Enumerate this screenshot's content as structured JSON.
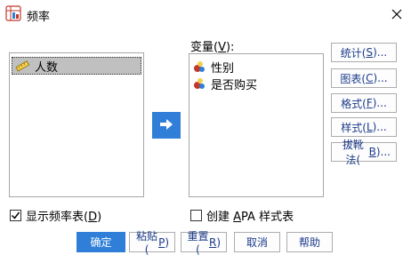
{
  "window": {
    "title": "频率"
  },
  "source_list": {
    "items": [
      {
        "label": "人数"
      }
    ]
  },
  "variables": {
    "label_pre": "变量(",
    "label_key": "V",
    "label_post": "):",
    "items": [
      {
        "label": "性别"
      },
      {
        "label": "是否购买"
      }
    ]
  },
  "side_buttons": [
    {
      "pre": "统计(",
      "key": "S",
      "post": ")..."
    },
    {
      "pre": "图表(",
      "key": "C",
      "post": ")..."
    },
    {
      "pre": "格式(",
      "key": "F",
      "post": ")..."
    },
    {
      "pre": "样式(",
      "key": "L",
      "post": ")..."
    },
    {
      "pre": "拔靴法(",
      "key": "B",
      "post": ")..."
    }
  ],
  "options": {
    "show_table": {
      "pre": "显示频率表(",
      "key": "D",
      "post": ")",
      "checked": true
    },
    "apa": {
      "pre": "创建 ",
      "key": "A",
      "post": "PA 样式表",
      "checked": false
    }
  },
  "bottom_buttons": {
    "ok": "确定",
    "paste": {
      "pre": "粘贴(",
      "key": "P",
      "post": ")"
    },
    "reset": {
      "pre": "重置(",
      "key": "R",
      "post": ")"
    },
    "cancel": "取消",
    "help": "帮助"
  },
  "colors": {
    "accent": "#2f7fd8",
    "button_text": "#1a3a8a"
  }
}
